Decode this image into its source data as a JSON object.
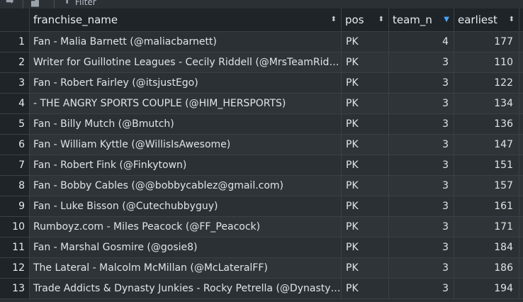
{
  "toolbar": {
    "filter_label": "Filter"
  },
  "columns": [
    {
      "label": "franchise_name",
      "sort": "⬍"
    },
    {
      "label": "pos",
      "sort": "⬍"
    },
    {
      "label": "team_n",
      "sort": "▼"
    },
    {
      "label": "earliest",
      "sort": "⬍"
    }
  ],
  "rows": [
    {
      "idx": "1",
      "franchise_name": "Fan - Malia Barnett (@maliacbarnett)",
      "pos": "PK",
      "team_n": "4",
      "earliest": "177"
    },
    {
      "idx": "2",
      "franchise_name": "Writer for Guillotine Leagues - Cecily Riddell (@MrsTeamRiddell)",
      "pos": "PK",
      "team_n": "3",
      "earliest": "110"
    },
    {
      "idx": "3",
      "franchise_name": "Fan - Robert Fairley (@itsjustEgo)",
      "pos": "PK",
      "team_n": "3",
      "earliest": "122"
    },
    {
      "idx": "4",
      "franchise_name": " - THE ANGRY SPORTS COUPLE (@HIM_HERSPORTS)",
      "pos": "PK",
      "team_n": "3",
      "earliest": "134"
    },
    {
      "idx": "5",
      "franchise_name": " Fan - Billy Mutch (@Bmutch)",
      "pos": "PK",
      "team_n": "3",
      "earliest": "136"
    },
    {
      "idx": "6",
      "franchise_name": "Fan - William Kyttle (@WillisIsAwesome)",
      "pos": "PK",
      "team_n": "3",
      "earliest": "147"
    },
    {
      "idx": "7",
      "franchise_name": " Fan - Robert Fink (@Finkytown)",
      "pos": "PK",
      "team_n": "3",
      "earliest": "151"
    },
    {
      "idx": "8",
      "franchise_name": "Fan - Bobby Cables (@@bobbycablez@gmail.com)",
      "pos": "PK",
      "team_n": "3",
      "earliest": "157"
    },
    {
      "idx": "9",
      "franchise_name": "Fan - Luke Bisson (@Cutechubbyguy)",
      "pos": "PK",
      "team_n": "3",
      "earliest": "161"
    },
    {
      "idx": "10",
      "franchise_name": "Rumboyz.com - Miles Peacock (@FF_Peacock)",
      "pos": "PK",
      "team_n": "3",
      "earliest": "171"
    },
    {
      "idx": "11",
      "franchise_name": "Fan - Marshal Gosmire (@gosie8)",
      "pos": "PK",
      "team_n": "3",
      "earliest": "184"
    },
    {
      "idx": "12",
      "franchise_name": "The Lateral - Malcolm McMillan (@McLateralFF)",
      "pos": "PK",
      "team_n": "3",
      "earliest": "186"
    },
    {
      "idx": "13",
      "franchise_name": "Trade Addicts & Dynasty Junkies - Rocky Petrella (@DynastyJunkies)",
      "pos": "PK",
      "team_n": "3",
      "earliest": "194"
    }
  ]
}
